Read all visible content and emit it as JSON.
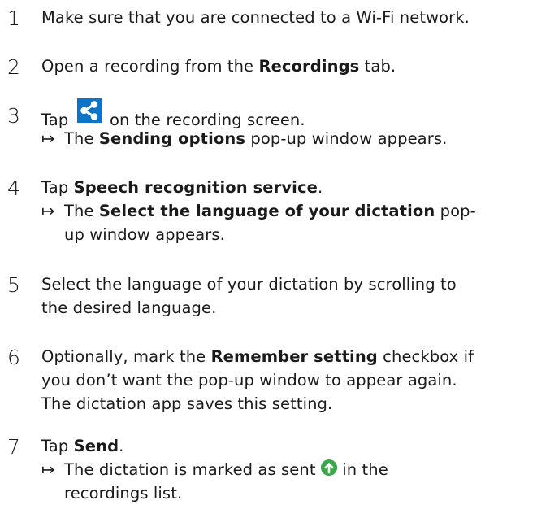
{
  "icons": {
    "share_icon": "share-icon",
    "sent_icon": "sent-icon",
    "share_icon_color": "#0b74c8",
    "sent_icon_color": "#3aa84a"
  },
  "steps": [
    {
      "number": "1",
      "text": "Make sure that you are connected to a Wi-Fi network."
    },
    {
      "number": "2",
      "before": "Open a recording from the ",
      "bold": "Recordings",
      "after": " tab."
    },
    {
      "number": "3",
      "before": "Tap",
      "after": "on the recording screen.",
      "result": {
        "arrow": "↦",
        "before": "The ",
        "bold": "Sending options",
        "after": " pop-up window appears."
      }
    },
    {
      "number": "4",
      "before": "Tap ",
      "bold": "Speech recognition service",
      "after": ".",
      "result": {
        "arrow": "↦",
        "before": "The ",
        "bold": "Select the language of your dictation",
        "after": " pop-",
        "line2": "up window appears."
      }
    },
    {
      "number": "5",
      "line1": "Select the language of your dictation by scrolling to",
      "line2": "the desired language."
    },
    {
      "number": "6",
      "before": "Optionally, mark the ",
      "bold": "Remember setting",
      "after": " checkbox if",
      "line2": "you don’t want the pop-up window to appear again.",
      "line3": "The dictation app saves this setting."
    },
    {
      "number": "7",
      "before": "Tap ",
      "bold": "Send",
      "after": ".",
      "result": {
        "arrow": "↦",
        "before": "The dictation is marked as sent",
        "after": "in the",
        "line2": "recordings list."
      }
    }
  ]
}
